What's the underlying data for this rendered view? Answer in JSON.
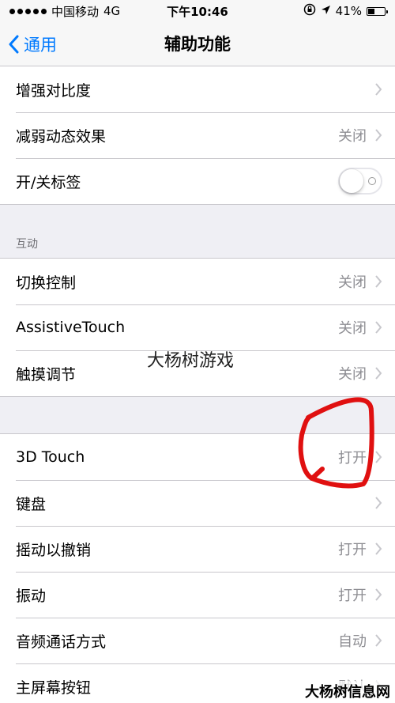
{
  "status_bar": {
    "carrier": "中国移动",
    "network": "4G",
    "time": "下午10:46",
    "battery": "41%",
    "battery_level": 0.41
  },
  "nav": {
    "back_label": "通用",
    "title": "辅助功能"
  },
  "group1": {
    "rows": [
      {
        "label": "增强对比度",
        "value": ""
      },
      {
        "label": "减弱动态效果",
        "value": "关闭"
      },
      {
        "label": "开/关标签",
        "toggle_on": false
      }
    ]
  },
  "section2_header": "互动",
  "group2": {
    "rows": [
      {
        "label": "切换控制",
        "value": "关闭"
      },
      {
        "label": "AssistiveTouch",
        "value": "关闭"
      },
      {
        "label": "触摸调节",
        "value": "关闭"
      }
    ]
  },
  "group3": {
    "rows": [
      {
        "label": "3D Touch",
        "value": "打开"
      },
      {
        "label": "键盘",
        "value": ""
      },
      {
        "label": "摇动以撤销",
        "value": "打开"
      },
      {
        "label": "振动",
        "value": "打开"
      },
      {
        "label": "音频通话方式",
        "value": "自动"
      },
      {
        "label": "主屏幕按钮",
        "value": "默认"
      }
    ]
  },
  "watermark": "大杨树游戏",
  "corner_watermark": "大杨树信息网",
  "colors": {
    "accent": "#007aff",
    "annotation": "#e01010"
  }
}
